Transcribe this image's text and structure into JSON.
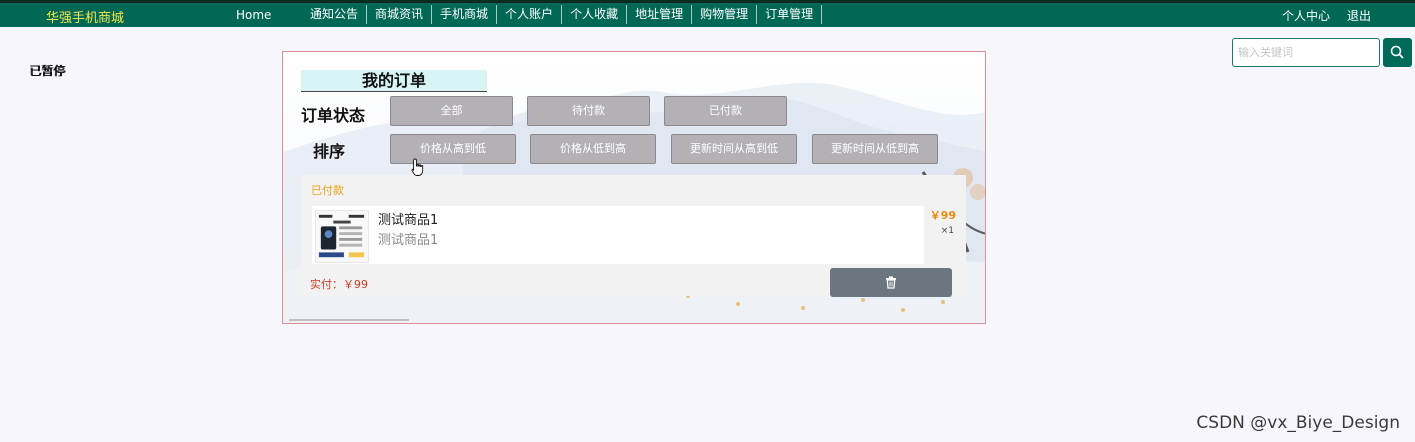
{
  "nav": {
    "brand": "华强手机商城",
    "home": "Home",
    "items": [
      "通知公告",
      "商城资讯",
      "手机商城",
      "个人账户",
      "个人收藏",
      "地址管理",
      "购物管理",
      "订单管理"
    ],
    "user_center": "个人中心",
    "logout": "退出"
  },
  "search": {
    "placeholder": "输入关键词",
    "icon": "search-icon"
  },
  "paused_label": "已暂停",
  "orders": {
    "title": "我的订单",
    "status_label": "订单状态",
    "sort_label": "排序",
    "status_filters": [
      "全部",
      "待付款",
      "已付款"
    ],
    "sort_options": [
      "价格从高到低",
      "价格从低到高",
      "更新时间从高到低",
      "更新时间从低到高"
    ],
    "card": {
      "status": "已付款",
      "product_name": "测试商品1",
      "product_desc": "测试商品1",
      "price": "￥99",
      "quantity": "×1",
      "paid_label": "实付：￥99",
      "delete_icon": "trash-icon"
    }
  },
  "watermark": "CSDN @vx_Biye_Design",
  "colors": {
    "navbar": "#006855",
    "brand": "#f5e64a",
    "button": "#b3b1b5",
    "status_paid": "#e9a41a",
    "price": "#ef8a13",
    "paid_total": "#d23b1d",
    "delete_button": "#6b7681"
  }
}
